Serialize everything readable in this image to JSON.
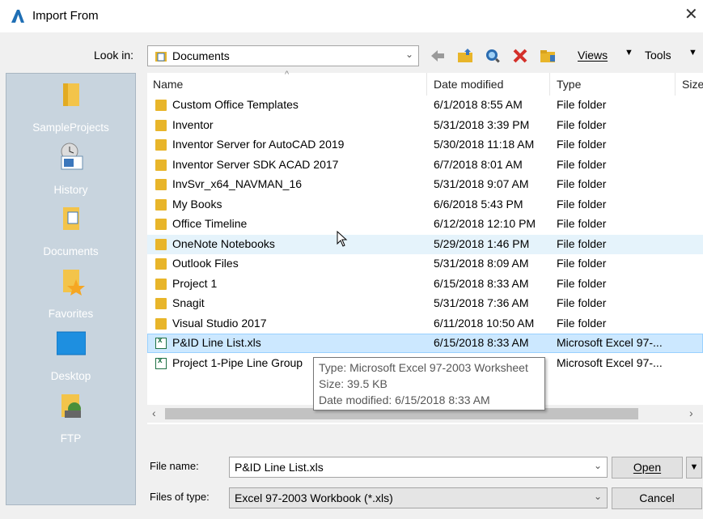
{
  "window": {
    "title": "Import From",
    "close_glyph": "✕"
  },
  "toolbar": {
    "lookin_label": "Look in:",
    "lookin_value": "Documents",
    "views_label": "Views",
    "tools_label": "Tools",
    "icons": [
      "back-icon",
      "up-folder-icon",
      "search-web-icon",
      "delete-icon",
      "new-folder-icon"
    ]
  },
  "sidebar": {
    "items": [
      {
        "label": "SampleProjects",
        "icon": "folder-icon"
      },
      {
        "label": "History",
        "icon": "history-icon"
      },
      {
        "label": "Documents",
        "icon": "documents-icon"
      },
      {
        "label": "Favorites",
        "icon": "favorites-icon"
      },
      {
        "label": "Desktop",
        "icon": "desktop-icon"
      },
      {
        "label": "FTP",
        "icon": "ftp-icon"
      }
    ]
  },
  "columns": {
    "name": "Name",
    "date": "Date modified",
    "type": "Type",
    "size": "Size"
  },
  "rows": [
    {
      "name": "Custom Office Templates",
      "date": "6/1/2018 8:55 AM",
      "type": "File folder",
      "kind": "folder"
    },
    {
      "name": "Inventor",
      "date": "5/31/2018 3:39 PM",
      "type": "File folder",
      "kind": "folder"
    },
    {
      "name": "Inventor Server for AutoCAD 2019",
      "date": "5/30/2018 11:18 AM",
      "type": "File folder",
      "kind": "folder"
    },
    {
      "name": "Inventor Server SDK ACAD 2017",
      "date": "6/7/2018 8:01 AM",
      "type": "File folder",
      "kind": "folder"
    },
    {
      "name": "InvSvr_x64_NAVMAN_16",
      "date": "5/31/2018 9:07 AM",
      "type": "File folder",
      "kind": "folder"
    },
    {
      "name": "My Books",
      "date": "6/6/2018 5:43 PM",
      "type": "File folder",
      "kind": "folder"
    },
    {
      "name": "Office Timeline",
      "date": "6/12/2018 12:10 PM",
      "type": "File folder",
      "kind": "folder"
    },
    {
      "name": "OneNote Notebooks",
      "date": "5/29/2018 1:46 PM",
      "type": "File folder",
      "kind": "folder"
    },
    {
      "name": "Outlook Files",
      "date": "5/31/2018 8:09 AM",
      "type": "File folder",
      "kind": "folder"
    },
    {
      "name": "Project 1",
      "date": "6/15/2018 8:33 AM",
      "type": "File folder",
      "kind": "folder"
    },
    {
      "name": "Snagit",
      "date": "5/31/2018 7:36 AM",
      "type": "File folder",
      "kind": "folder"
    },
    {
      "name": "Visual Studio 2017",
      "date": "6/11/2018 10:50 AM",
      "type": "File folder",
      "kind": "folder"
    },
    {
      "name": "P&ID Line List.xls",
      "date": "6/15/2018 8:33 AM",
      "type": "Microsoft Excel 97-...",
      "kind": "xls"
    },
    {
      "name": "Project 1-Pipe Line Group",
      "date": "",
      "type": "Microsoft Excel 97-...",
      "kind": "xls"
    }
  ],
  "tooltip": {
    "type_line": "Type: Microsoft Excel 97-2003 Worksheet",
    "size_line": "Size: 39.5 KB",
    "date_line": "Date modified: 6/15/2018 8:33 AM"
  },
  "bottom": {
    "filename_label": "File name:",
    "filename_value": "P&ID Line List.xls",
    "filetype_label": "Files of type:",
    "filetype_value": "Excel 97-2003 Workbook (*.xls)",
    "open_label": "Open",
    "cancel_label": "Cancel"
  }
}
